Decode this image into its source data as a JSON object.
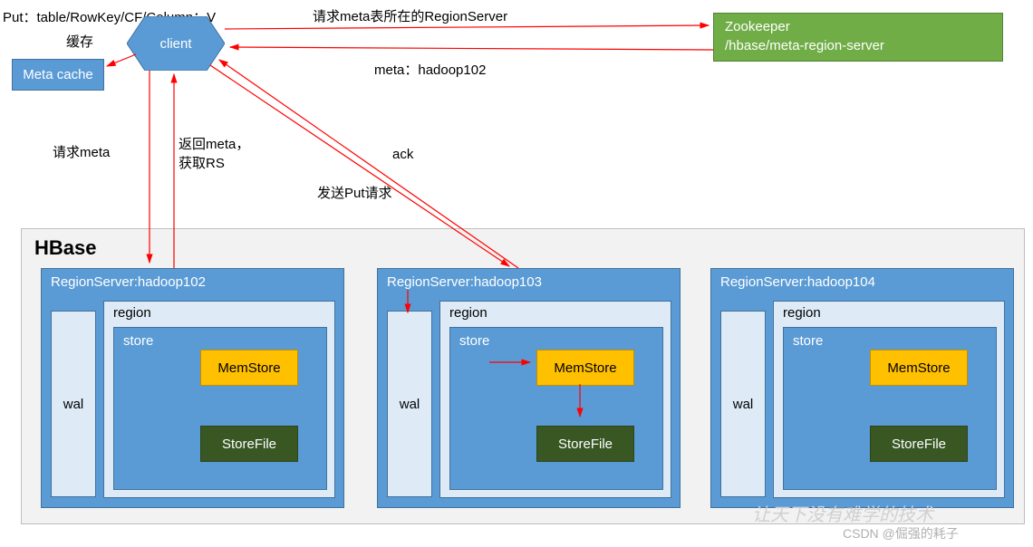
{
  "put_text": "Put：table/RowKey/CF/Column：V",
  "cache_label": "缓存",
  "client_label": "client",
  "meta_cache_label": "Meta cache",
  "zookeeper": {
    "line1": "Zookeeper",
    "line2": "/hbase/meta-region-server"
  },
  "labels": {
    "req_meta_rs": "请求meta表所在的RegionServer",
    "meta_hadoop": "meta：hadoop102",
    "req_meta": "请求meta",
    "return_meta_l1": "返回meta，",
    "return_meta_l2": "获取RS",
    "ack": "ack",
    "send_put": "发送Put请求"
  },
  "hbase": {
    "title": "HBase",
    "rs1": "RegionServer:hadoop102",
    "rs2": "RegionServer:hadoop103",
    "rs3": "RegionServer:hadoop104",
    "wal": "wal",
    "region": "region",
    "store": "store",
    "memstore": "MemStore",
    "storefile": "StoreFile"
  },
  "watermark": "让天下没有难学的技术",
  "csdn": "CSDN @倔强的耗子"
}
